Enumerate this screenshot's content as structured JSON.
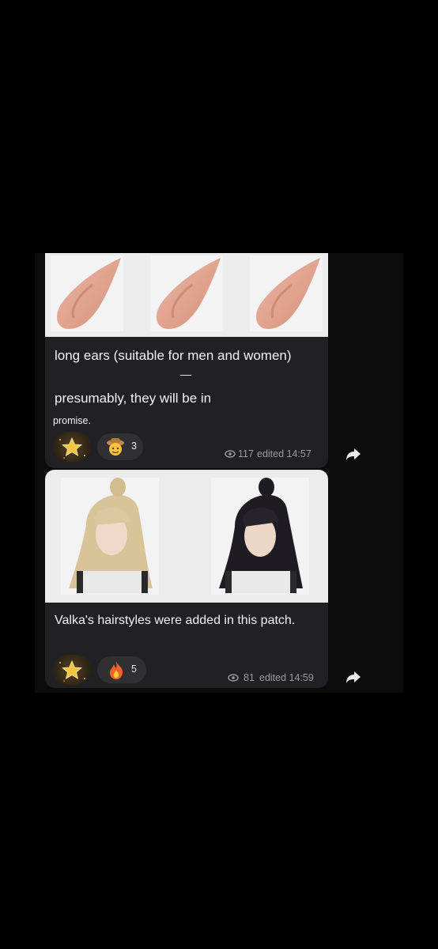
{
  "messages": [
    {
      "text_main": "long ears (suitable for men and women)",
      "separator": "—",
      "text_second": "presumably, they will be in",
      "text_small": "promise.",
      "reaction_count": "3",
      "views": "117",
      "edited": "edited 14:57"
    },
    {
      "text_main": "Valka's hairstyles were added in this patch.",
      "reaction_count": "5",
      "views": "81",
      "edited": "edited 14:59"
    }
  ]
}
